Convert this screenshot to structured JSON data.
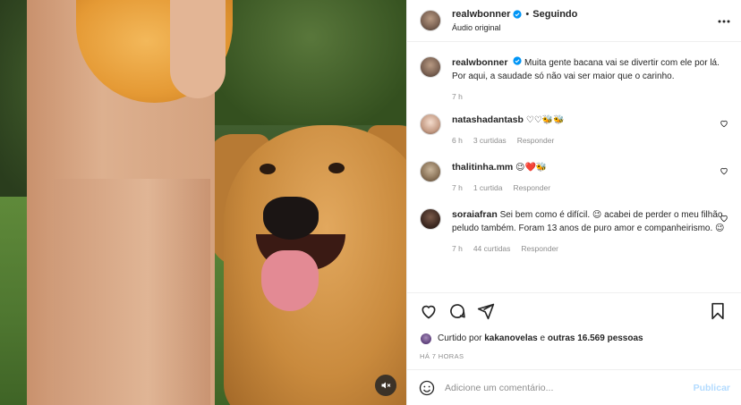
{
  "post": {
    "username": "realwbonner",
    "follow_separator": "•",
    "follow_status": "Seguindo",
    "audio": "Áudio original",
    "caption_author": "realwbonner",
    "caption": "Muita gente bacana vai se divertir com ele por lá. Por aqui, a saudade só não vai ser maior que o carinho.",
    "caption_time": "7 h"
  },
  "comments": [
    {
      "author": "natashadantasb",
      "text": "♡♡🐝🐝",
      "time": "6 h",
      "replies": "3 curtidas",
      "reply_label": "Responder"
    },
    {
      "author": "thalitinha.mm",
      "text": "😉❤️🐝",
      "time": "7 h",
      "replies": "1 curtida",
      "reply_label": "Responder"
    },
    {
      "author": "soraiafran",
      "text": "Sei bem como é difícil. 😉 acabei de perder o meu filhão peludo também. Foram 13 anos de puro amor e companheirismo. 😉",
      "time": "7 h",
      "replies": "44 curtidas",
      "reply_label": "Responder"
    }
  ],
  "likes": {
    "prefix": "Curtido por",
    "user": "kakanovelas",
    "middle": "e",
    "others": "outras 16.569 pessoas"
  },
  "time_ago": "HÁ 7 HORAS",
  "add_comment": {
    "placeholder": "Adicione um comentário...",
    "post_label": "Publicar"
  },
  "icons": {
    "more": "more-dots-icon",
    "heart": "heart-icon",
    "comment": "comment-icon",
    "share": "share-icon",
    "save": "bookmark-icon",
    "emoji": "emoji-icon",
    "mute": "muted-speaker-icon",
    "verified": "verified-badge-icon"
  },
  "colors": {
    "verified_blue": "#0095f6",
    "publish_disabled": "#b3dbff",
    "secondary_text": "#8e8e8e"
  }
}
